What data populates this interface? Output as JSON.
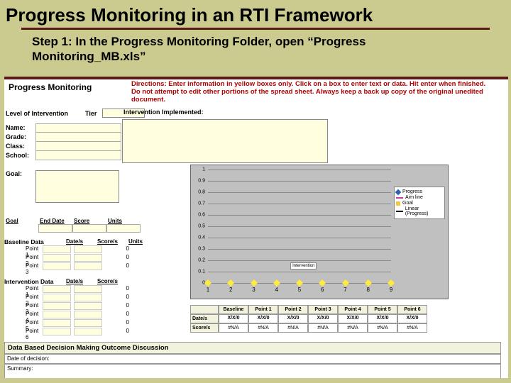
{
  "title": "Progress Monitoring in an RTI Framework",
  "step": "Step 1: In the Progress Monitoring Folder, open “Progress Monitoring_MB.xls”",
  "sheet": {
    "header_title": "Progress Monitoring",
    "directions_1": "Directions: Enter information in yellow boxes only. Click on a box to enter text or data. Hit enter when finished.",
    "directions_2": "Do not attempt to edit other portions of the spread sheet. Always keep a back up copy of the original unedited document.",
    "level_label": "Level of Intervention",
    "tier_label": "Tier",
    "intervention_label": "Intervention Implemented:",
    "info": {
      "name": "Name:",
      "grade": "Grade:",
      "class": "Class:",
      "school": "School:"
    },
    "goal_label": "Goal:",
    "goal_table": {
      "c1": "Goal",
      "c2": "End Date",
      "c3": "Score",
      "c4": "Units"
    },
    "baseline": {
      "title": "Baseline Data",
      "date_h": "Date/s",
      "score_h": "Score/s",
      "units_h": "Units",
      "rows": [
        "Point 1",
        "Point 2",
        "Point 3"
      ],
      "vals": [
        "0",
        "0",
        "0"
      ]
    },
    "interv": {
      "title": "Intervention Data",
      "date_h": "Date/s",
      "score_h": "Score/s",
      "rows": [
        "Point 1",
        "Point 2",
        "Point 3",
        "Point 4",
        "Point 5",
        "Point 6"
      ],
      "vals": [
        "0",
        "0",
        "0",
        "0",
        "0",
        "0"
      ]
    },
    "points_table": {
      "cols": [
        "Baseline X/X/0",
        "Point 1 X/X/0",
        "Point 2 X/X/0",
        "Point 3 X/X/0",
        "Point 4 X/X/0",
        "Point 5 X/X/0",
        "Point 6 X/X/0"
      ],
      "row1": "Date/s",
      "row2": "Score/s",
      "cells": [
        "#N/A",
        "#N/A",
        "#N/A",
        "#N/A",
        "#N/A",
        "#N/A",
        "#N/A"
      ]
    },
    "discussion": {
      "title": "Data Based Decision Making Outcome Discussion",
      "date_label": "Date of decision:",
      "summary_label": "Summary:"
    }
  },
  "chart_data": {
    "type": "line",
    "title": "",
    "xlabel": "",
    "ylabel": "",
    "x": [
      1,
      2,
      3,
      4,
      5,
      6,
      7,
      8,
      9
    ],
    "ylim": [
      0,
      1
    ],
    "yticks": [
      0,
      0.1,
      0.2,
      0.3,
      0.4,
      0.5,
      0.6,
      0.7,
      0.8,
      0.9,
      1
    ],
    "series": [
      {
        "name": "Progress",
        "color": "#2b5fb8",
        "values": []
      },
      {
        "name": "Aim line",
        "color": "#c53aa0",
        "values": []
      },
      {
        "name": "Goal",
        "color": "#f2c744",
        "values": [
          0,
          0,
          0,
          0,
          0,
          0,
          0,
          0,
          0
        ]
      },
      {
        "name": "Linear (Progress)",
        "color": "#000000",
        "values": []
      }
    ],
    "annotation": "Intervention"
  }
}
